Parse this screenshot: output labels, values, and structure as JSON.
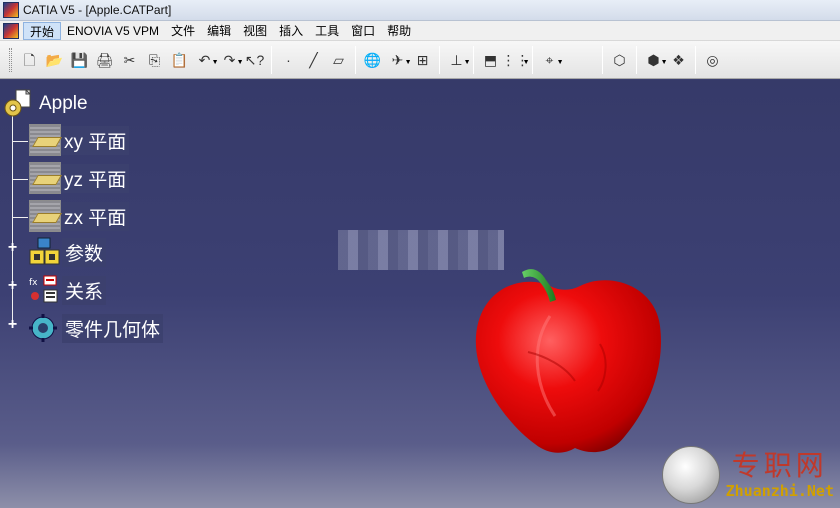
{
  "window": {
    "title": "CATIA V5 - [Apple.CATPart]"
  },
  "menu": {
    "items": [
      "开始",
      "ENOVIA V5 VPM",
      "文件",
      "编辑",
      "视图",
      "插入",
      "工具",
      "窗口",
      "帮助"
    ]
  },
  "toolbar": {
    "icons": [
      {
        "name": "new-icon",
        "glyph": "🗋"
      },
      {
        "name": "open-icon",
        "glyph": "📂"
      },
      {
        "name": "save-icon",
        "glyph": "💾"
      },
      {
        "name": "print-icon",
        "glyph": "🖨"
      },
      {
        "name": "cut-icon",
        "glyph": "✂"
      },
      {
        "name": "copy-icon",
        "glyph": "⎘"
      },
      {
        "name": "paste-icon",
        "glyph": "📋"
      },
      {
        "name": "undo-icon",
        "glyph": "↶"
      },
      {
        "name": "redo-icon",
        "glyph": "↷"
      },
      {
        "name": "whats-this-icon",
        "glyph": "↖?"
      },
      {
        "name": "point-icon",
        "glyph": "·"
      },
      {
        "name": "line-icon",
        "glyph": "╱"
      },
      {
        "name": "plane-icon",
        "glyph": "▱"
      },
      {
        "name": "globe-icon",
        "glyph": "🌐"
      },
      {
        "name": "fly-mode-icon",
        "glyph": "✈"
      },
      {
        "name": "tree-icon",
        "glyph": "⊞"
      },
      {
        "name": "measure-icon",
        "glyph": "⊥"
      },
      {
        "name": "view-icon",
        "glyph": "⬒"
      },
      {
        "name": "grid-icon",
        "glyph": "⋮⋮"
      },
      {
        "name": "fit-all-icon",
        "glyph": "⌖"
      },
      {
        "name": "part-body-icon",
        "glyph": "⬡"
      },
      {
        "name": "catalog-icon",
        "glyph": "⬢"
      },
      {
        "name": "material-icon",
        "glyph": "❖"
      },
      {
        "name": "rendering-icon",
        "glyph": "◎"
      }
    ]
  },
  "tree": {
    "root": "Apple",
    "items": [
      {
        "label": "xy 平面"
      },
      {
        "label": "yz 平面"
      },
      {
        "label": "zx 平面"
      },
      {
        "label": "参数"
      },
      {
        "label": "关系"
      },
      {
        "label": "零件几何体"
      }
    ]
  },
  "colors": {
    "apple": "#e60000",
    "stem": "#2e9a2e",
    "background": "#3b3f6e"
  },
  "watermark": {
    "cn": "专职网",
    "en": "Zhuanzhi.Net"
  }
}
